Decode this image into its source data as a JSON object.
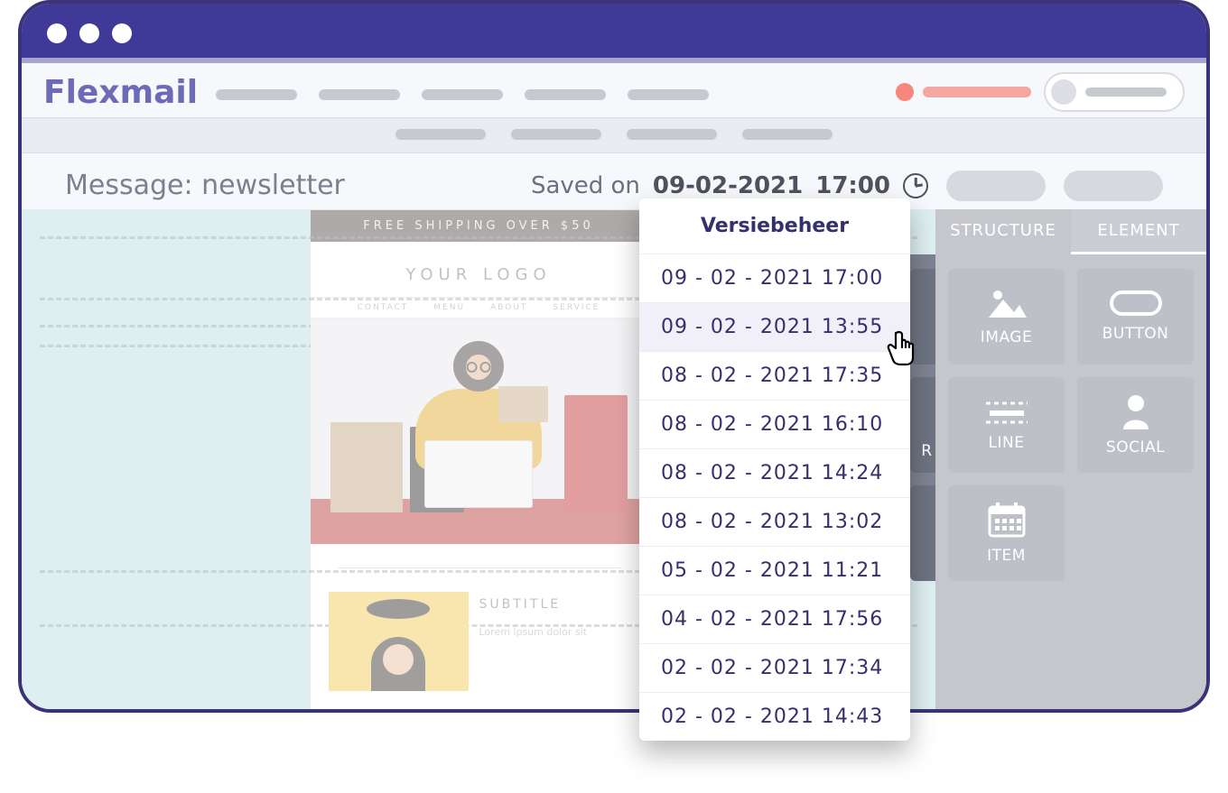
{
  "brand": "Flexmail",
  "page": {
    "title_prefix": "Message:",
    "title_value": "newsletter"
  },
  "saved": {
    "prefix": "Saved on",
    "date": "09-02-2021",
    "time": "17:00"
  },
  "version_popup": {
    "title": "Versiebeheer",
    "items": [
      "09 - 02 - 2021  17:00",
      "09 - 02 - 2021  13:55",
      "08 - 02 - 2021  17:35",
      "08 - 02 - 2021  16:10",
      "08 - 02 - 2021  14:24",
      "08 - 02 - 2021  13:02",
      "05 - 02 - 2021  11:21",
      "04 - 02 - 2021  17:56",
      "02 - 02 - 2021  17:34",
      "02 - 02 - 2021  14:43"
    ],
    "hover_index": 1
  },
  "panel": {
    "tabs": {
      "structure": "STRUCTURE",
      "element": "ELEMENT"
    },
    "elements": {
      "image": "IMAGE",
      "button": "BUTTON",
      "line": "LINE",
      "social": "SOCIAL",
      "item": "ITEM",
      "spacer_partial": "R"
    }
  },
  "email": {
    "banner": "FREE SHIPPING OVER $50",
    "logo": "YOUR LOGO",
    "menu": {
      "contact": "CONTACT",
      "menu": "MENU",
      "about": "ABOUT",
      "service": "SERVICE"
    },
    "subtitle": "SUBTITLE",
    "lorem": "Lorem ipsum dolor sit"
  }
}
